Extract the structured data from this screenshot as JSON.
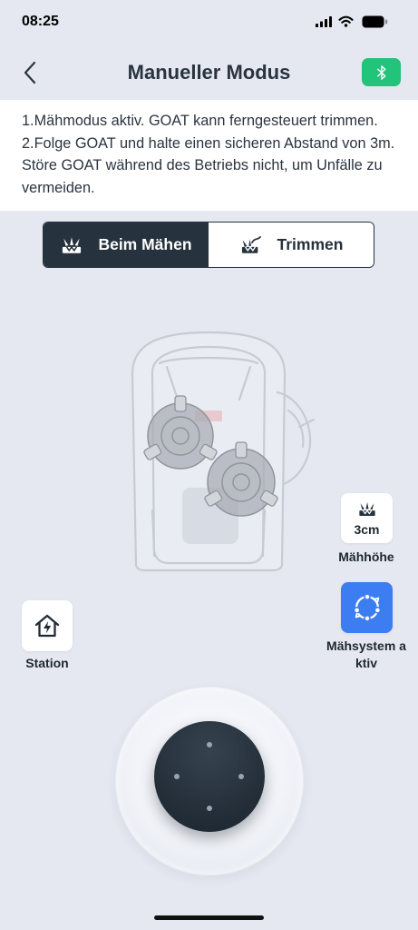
{
  "status_bar": {
    "time": "08:25",
    "icons": [
      "signal-icon",
      "wifi-icon",
      "battery-icon"
    ]
  },
  "header": {
    "title": "Manueller Modus",
    "back_icon": "chevron-left-icon",
    "bluetooth_icon": "bluetooth-icon"
  },
  "info": {
    "lines": [
      "1.Mähmodus aktiv. GOAT kann ferngesteuert trimmen.",
      "2.Folge GOAT und halte einen sicheren Abstand von 3m.",
      "Störe GOAT während des Betriebs nicht, um Unfälle zu",
      "vermeiden."
    ]
  },
  "mode_toggle": {
    "options": [
      {
        "label": "Beim Mähen",
        "icon": "mowing-icon",
        "selected": true
      },
      {
        "label": "Trimmen",
        "icon": "trimming-icon",
        "selected": false
      }
    ]
  },
  "illustration": {
    "icon": "robot-mower-illustration"
  },
  "controls": {
    "cutting_height": {
      "value": "3cm",
      "label": "Mähhöhe",
      "icon": "cutting-height-icon"
    },
    "cutting_system": {
      "label": "Mähsystem aktiv",
      "icon": "blade-rotation-icon"
    },
    "station": {
      "label": "Station",
      "icon": "home-charging-icon"
    }
  },
  "joystick": {
    "icon": "joystick-icon"
  },
  "colors": {
    "background": "#e5e8f1",
    "dark": "#26323e",
    "accent_blue": "#3d7df2",
    "accent_green": "#22c37b",
    "info_background": "#ffffff"
  }
}
